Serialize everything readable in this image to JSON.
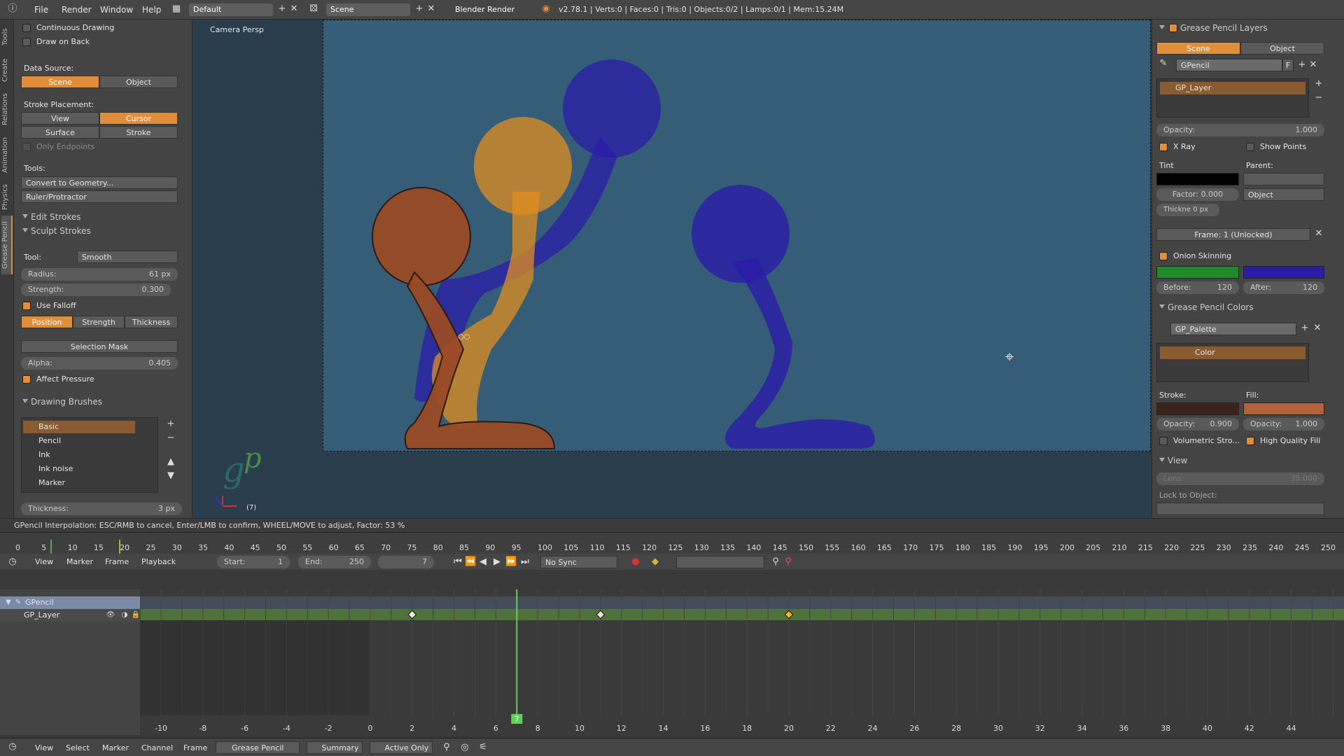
{
  "topbar": {
    "menus": [
      "File",
      "Render",
      "Window",
      "Help"
    ],
    "layout": "Default",
    "scene": "Scene",
    "engine": "Blender Render",
    "stats": "v2.78.1 | Verts:0 | Faces:0 | Tris:0 | Objects:0/2 | Lamps:0/1 | Mem:15.24M"
  },
  "side_tabs": [
    "Tools",
    "Create",
    "Relations",
    "Animation",
    "Physics",
    "Grease Pencil"
  ],
  "toolshelf": {
    "continuous_drawing": "Continuous Drawing",
    "draw_on_back": "Draw on Back",
    "data_source_label": "Data Source:",
    "data_source_scene": "Scene",
    "data_source_object": "Object",
    "stroke_placement_label": "Stroke Placement:",
    "sp_view": "View",
    "sp_cursor": "Cursor",
    "sp_surface": "Surface",
    "sp_stroke": "Stroke",
    "only_endpoints": "Only Endpoints",
    "tools_label": "Tools:",
    "convert": "Convert to Geometry...",
    "ruler": "Ruler/Protractor",
    "edit_strokes": "Edit Strokes",
    "sculpt_strokes": "Sculpt Strokes",
    "tool_label": "Tool:",
    "tool_value": "Smooth",
    "radius_label": "Radius:",
    "radius_value": "61 px",
    "strength_label": "Strength:",
    "strength_value": "0.300",
    "use_falloff": "Use Falloff",
    "position": "Position",
    "strength": "Strength",
    "thickness": "Thickness",
    "selection_mask": "Selection Mask",
    "alpha_label": "Alpha:",
    "alpha_value": "0.405",
    "affect_pressure": "Affect Pressure",
    "drawing_brushes": "Drawing Brushes",
    "brushes": [
      "Basic",
      "Pencil",
      "Ink",
      "Ink noise",
      "Marker"
    ],
    "thickness_label": "Thickness:",
    "thickness_value": "3 px"
  },
  "viewport": {
    "label": "Camera Persp",
    "frame_indicator": "(7)"
  },
  "props": {
    "layers_title": "Grease Pencil Layers",
    "scene_tab": "Scene",
    "object_tab": "Object",
    "gpencil_name": "GPencil",
    "f_label": "F",
    "layer_name": "GP_Layer",
    "opacity_label": "Opacity:",
    "opacity_value": "1.000",
    "xray": "X Ray",
    "show_points": "Show Points",
    "tint": "Tint",
    "parent": "Parent:",
    "factor_label": "Factor:",
    "factor_value": "0.000",
    "parent_type": "Object",
    "thickness_label": "Thickne",
    "thickness_value": "0 px",
    "frame": "Frame: 1 (Unlocked)",
    "onion_skinning": "Onion Skinning",
    "before_label": "Before:",
    "before_value": "120",
    "after_label": "After:",
    "after_value": "120",
    "colors_title": "Grease Pencil Colors",
    "palette": "GP_Palette",
    "color_name": "Color",
    "stroke_label": "Stroke:",
    "fill_label": "Fill:",
    "stroke_opacity_label": "Opacity:",
    "stroke_opacity_value": "0.900",
    "fill_opacity_label": "Opacity:",
    "fill_opacity_value": "1.000",
    "volumetric": "Volumetric Stro...",
    "hq_fill": "High Quality Fill",
    "view_title": "View",
    "lens_label": "Lens:",
    "lens_value": "35.000",
    "lock_to_object": "Lock to Object:"
  },
  "colors": {
    "accent": "#e08e3a",
    "onion_before": "#1f8a2a",
    "onion_after": "#2a1ca8",
    "stroke_swatch": "#3a241a",
    "fill_swatch": "#b5623a",
    "tint_swatch": "#000000",
    "keyframe_selected": "#f5b629"
  },
  "statusbar": "GPencil Interpolation: ESC/RMB to cancel, Enter/LMB to confirm, WHEEL/MOVE to adjust, Factor: 53 %",
  "timeline": {
    "ticks": [
      "0",
      "5",
      "10",
      "15",
      "20",
      "25",
      "30",
      "35",
      "40",
      "45",
      "50",
      "55",
      "60",
      "65",
      "70",
      "75",
      "80",
      "85",
      "90",
      "95",
      "100",
      "105",
      "110",
      "115",
      "120",
      "125",
      "130",
      "135",
      "140",
      "145",
      "150",
      "155",
      "160",
      "165",
      "170",
      "175",
      "180",
      "185",
      "190",
      "195",
      "200",
      "205",
      "210",
      "215",
      "220",
      "225",
      "230",
      "235",
      "240",
      "245",
      "250"
    ],
    "menus": [
      "View",
      "Marker",
      "Frame",
      "Playback"
    ],
    "start_label": "Start:",
    "start_value": "1",
    "end_label": "End:",
    "end_value": "250",
    "current_frame": "7",
    "sync": "No Sync"
  },
  "dopesheet": {
    "channel_object": "GPencil",
    "channel_layer": "GP_Layer",
    "ticks": [
      "-10",
      "-8",
      "-6",
      "-4",
      "-2",
      "0",
      "2",
      "4",
      "6",
      "8",
      "10",
      "12",
      "14",
      "16",
      "18",
      "20",
      "22",
      "24",
      "26",
      "28",
      "30",
      "32",
      "34",
      "36",
      "38",
      "40",
      "42",
      "44"
    ],
    "current_frame": "7",
    "keyframes": [
      2,
      11,
      20
    ]
  },
  "bottombar": {
    "menus": [
      "View",
      "Select",
      "Marker",
      "Channel",
      "Frame"
    ],
    "mode": "Grease Pencil",
    "summary": "Summary",
    "active_only": "Active Only"
  }
}
